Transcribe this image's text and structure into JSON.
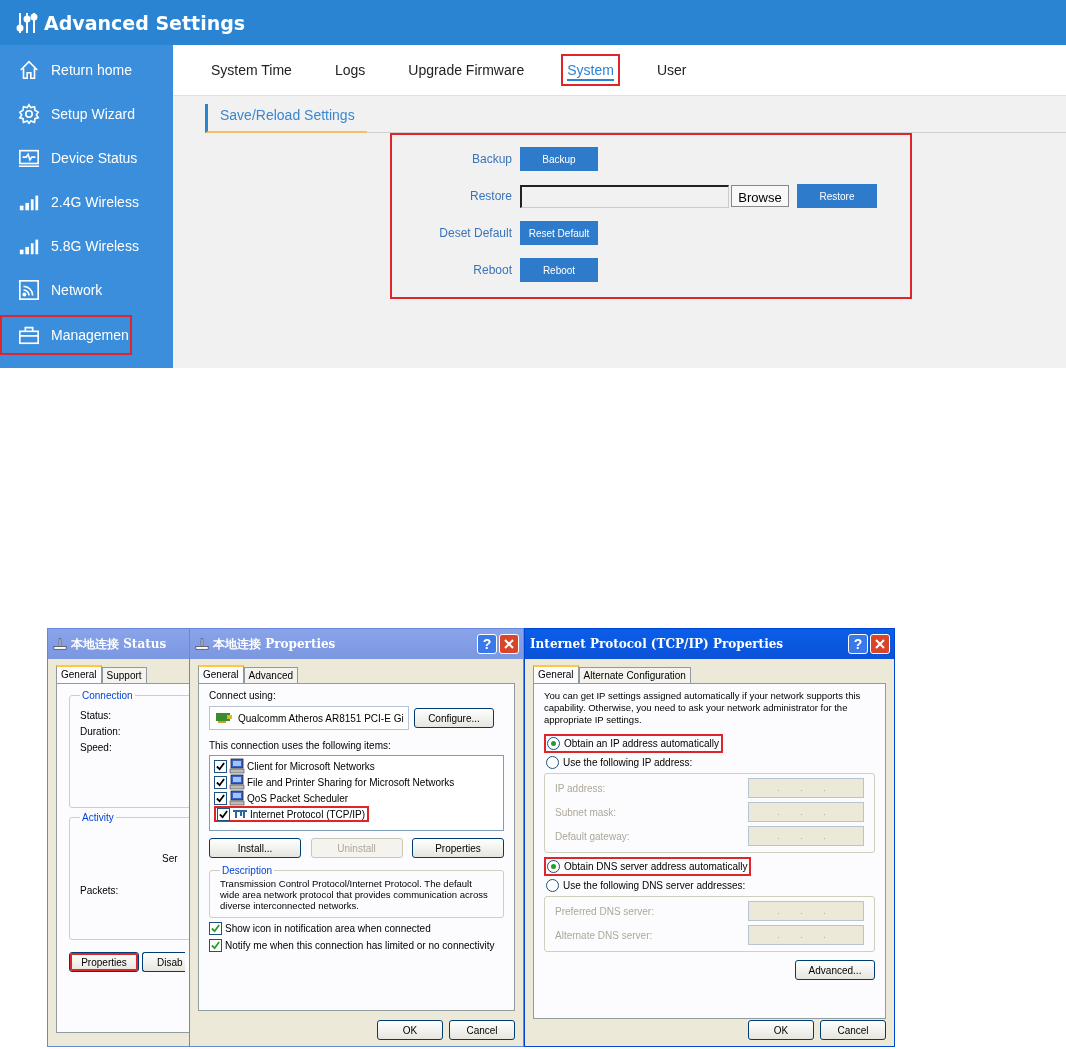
{
  "header": {
    "title": "Advanced Settings"
  },
  "sidebar": {
    "items": [
      {
        "label": "Return home",
        "highlighted": false
      },
      {
        "label": "Setup Wizard",
        "highlighted": false
      },
      {
        "label": "Device Status",
        "highlighted": false
      },
      {
        "label": "2.4G Wireless",
        "highlighted": false
      },
      {
        "label": "5.8G Wireless",
        "highlighted": false
      },
      {
        "label": "Network",
        "highlighted": false
      },
      {
        "label": "Managemen",
        "highlighted": true
      }
    ]
  },
  "tabs": [
    {
      "label": "System Time",
      "selected": false,
      "highlighted": false
    },
    {
      "label": "Logs",
      "selected": false,
      "highlighted": false
    },
    {
      "label": "Upgrade Firmware",
      "selected": false,
      "highlighted": false
    },
    {
      "label": "System",
      "selected": true,
      "highlighted": true
    },
    {
      "label": "User",
      "selected": false,
      "highlighted": false
    }
  ],
  "section_title": "Save/Reload Settings",
  "form": {
    "highlighted": true,
    "rows": [
      {
        "kind": "button",
        "label": "Backup",
        "button": "Backup"
      },
      {
        "kind": "file",
        "label": "Restore",
        "browse": "Browse",
        "button": "Restore"
      },
      {
        "kind": "button",
        "label": "Deset Default",
        "button": "Reset Default"
      },
      {
        "kind": "button",
        "label": "Reboot",
        "button": "Reboot"
      }
    ]
  },
  "status_window": {
    "title": "本地连接 Status",
    "tabs": [
      {
        "label": "General",
        "selected": true
      },
      {
        "label": "Support",
        "selected": false
      }
    ],
    "connection": {
      "title": "Connection",
      "labels": [
        "Status:",
        "Duration:",
        "Speed:"
      ]
    },
    "activity": {
      "title": "Activity",
      "sent": "Ser",
      "packets": "Packets:"
    },
    "buttons": [
      {
        "label": "Properties",
        "highlighted": true
      },
      {
        "label": "Disab",
        "highlighted": false
      }
    ]
  },
  "properties_window": {
    "title": "本地连接 Properties",
    "help": "?",
    "tabs": [
      {
        "label": "General",
        "selected": true
      },
      {
        "label": "Advanced",
        "selected": false
      }
    ],
    "connect_using": "Connect using:",
    "adapter": "Qualcomm Atheros AR8151 PCI-E Gi",
    "configure": "Configure...",
    "items_label": "This connection uses the following items:",
    "items": [
      {
        "kind": "client",
        "label": "Client for Microsoft Networks",
        "checked": true,
        "highlighted": false
      },
      {
        "kind": "client",
        "label": "File and Printer Sharing for Microsoft Networks",
        "checked": true,
        "highlighted": false
      },
      {
        "kind": "client",
        "label": "QoS Packet Scheduler",
        "checked": true,
        "highlighted": false
      },
      {
        "kind": "protocol",
        "label": "Internet Protocol (TCP/IP)",
        "checked": true,
        "highlighted": true
      }
    ],
    "buttons": [
      {
        "label": "Install...",
        "disabled": false
      },
      {
        "label": "Uninstall",
        "disabled": true
      },
      {
        "label": "Properties",
        "disabled": false
      }
    ],
    "description": {
      "title": "Description",
      "text": "Transmission Control Protocol/Internet Protocol. The default wide area network protocol that provides communication across diverse interconnected networks."
    },
    "checkboxes": [
      {
        "label": "Show icon in notification area when connected",
        "checked": true
      },
      {
        "label": "Notify me when this connection has limited or no connectivity",
        "checked": true
      }
    ],
    "footer": [
      "OK",
      "Cancel"
    ]
  },
  "tcpip_window": {
    "title": "Internet Protocol (TCP/IP) Properties",
    "help": "?",
    "tabs": [
      {
        "label": "General",
        "selected": true
      },
      {
        "label": "Alternate Configuration",
        "selected": false
      }
    ],
    "intro": "You can get IP settings assigned automatically if your network supports this capability. Otherwise, you need to ask your network administrator for the appropriate IP settings.",
    "sections": [
      {
        "auto": {
          "label": "Obtain an IP address automatically",
          "selected": true,
          "highlighted": true
        },
        "manual": {
          "label": "Use the following IP address:",
          "selected": false
        },
        "fields": [
          {
            "label": "IP address:",
            "value": ". . ."
          },
          {
            "label": "Subnet mask:",
            "value": ". . ."
          },
          {
            "label": "Default gateway:",
            "value": ". . ."
          }
        ]
      },
      {
        "auto": {
          "label": "Obtain DNS server address automatically",
          "selected": true,
          "highlighted": true
        },
        "manual": {
          "label": "Use the following DNS server addresses:",
          "selected": false
        },
        "fields": [
          {
            "label": "Preferred DNS server:",
            "value": ". . ."
          },
          {
            "label": "Alternate DNS server:",
            "value": ". . ."
          }
        ]
      }
    ],
    "advanced": "Advanced...",
    "footer": [
      "OK",
      "Cancel"
    ]
  }
}
